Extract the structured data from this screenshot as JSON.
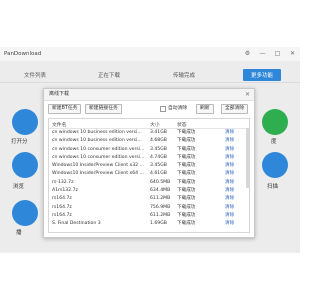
{
  "app": {
    "title": "PanDownload",
    "window_controls": [
      "⚙",
      "—",
      "□",
      "✕"
    ]
  },
  "tabs": [
    {
      "label": "文件列表",
      "active": false
    },
    {
      "label": "正在下载",
      "active": false
    },
    {
      "label": "传输完成",
      "active": false
    },
    {
      "label": "更多功能",
      "active": true
    }
  ],
  "side_labels": {
    "left_1": "打开分",
    "left_2": "浏览",
    "left_3": "播",
    "right_1": "度",
    "right_2": "扫描"
  },
  "dialog": {
    "title": "离线下载",
    "close": "✕",
    "buttons": {
      "new_bt": "新建BT任务",
      "new_link": "新建链接任务",
      "refresh": "刷新",
      "clear_all": "全部清除"
    },
    "auto_clear_label": "自动清除",
    "columns": {
      "name": "文件名",
      "size": "大小",
      "status": "状态"
    },
    "rows": [
      {
        "name": "cn windows 10 business edition versi...",
        "size": "3.41GB",
        "status": "下载成功",
        "action": "清除"
      },
      {
        "name": "cn windows 10 business edition versi...",
        "size": "4.68GB",
        "status": "下载成功",
        "action": "清除"
      },
      {
        "name": "cn windows 10 consumer edition versi...",
        "size": "3.45GB",
        "status": "下载成功",
        "action": "清除"
      },
      {
        "name": "cn windows 10 consumer edition versi...",
        "size": "4.74GB",
        "status": "下载成功",
        "action": "清除"
      },
      {
        "name": "Windows10 InsiderPreview Client x32 ...",
        "size": "3.45GB",
        "status": "下载成功",
        "action": "清除"
      },
      {
        "name": "Windows10 InsiderPreview Client x64 ...",
        "size": "4.61GB",
        "status": "下载成功",
        "action": "清除"
      },
      {
        "name": "rs-132.7z",
        "size": "640.5MB",
        "status": "下载成功",
        "action": "清除"
      },
      {
        "name": "A1rs132.7z",
        "size": "634.4MB",
        "status": "下载成功",
        "action": "清除"
      },
      {
        "name": "rs164.7z",
        "size": "611.2MB",
        "status": "下载成功",
        "action": "清除"
      },
      {
        "name": "rs164.7z",
        "size": "756.9MB",
        "status": "下载成功",
        "action": "清除"
      },
      {
        "name": "rs164.7z",
        "size": "611.2MB",
        "status": "下载成功",
        "action": "清除"
      },
      {
        "name": "S. Final Destination 3",
        "size": "1.69GB",
        "status": "下载成功",
        "action": "清除"
      }
    ]
  },
  "colors": {
    "accent": "#2e87d8",
    "green": "#2fae4f",
    "link": "#2a63c9"
  }
}
